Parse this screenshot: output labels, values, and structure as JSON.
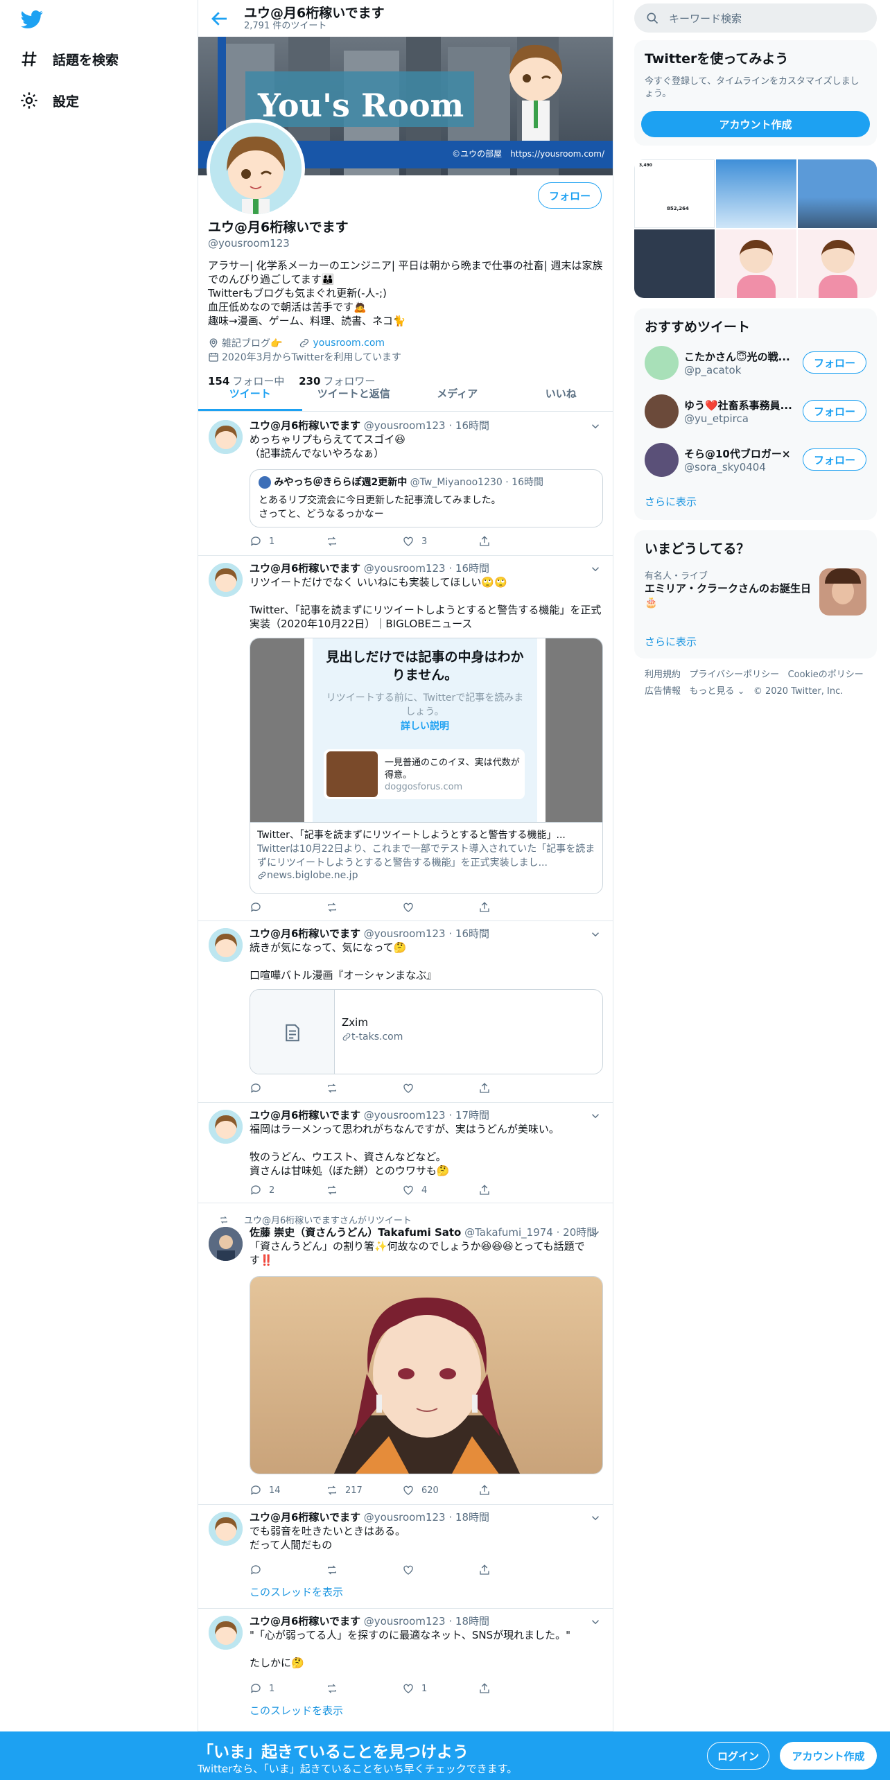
{
  "nav": {
    "logo_icon": "twitter-bird-icon",
    "explore": "話題を検索",
    "settings": "設定"
  },
  "header": {
    "name": "ユウ@月6桁稼いでます",
    "tweet_count": "2,791 件のツイート"
  },
  "banner": {
    "title": "You's Room",
    "caption": "©ユウの部屋　https://yousroom.com/"
  },
  "profile": {
    "follow_label": "フォロー",
    "name": "ユウ@月6桁稼いでます",
    "handle": "@yousroom123",
    "bio": "アラサー| 化学系メーカーのエンジニア| 平日は朝から晩まで仕事の社畜| 週末は家族でのんびり過ごしてます👪\nTwitterもブログも気まぐれ更新(-人-;)\n血圧低めなので朝活は苦手です🙇\n趣味→漫画、ゲーム、料理、読書、ネコ🐈",
    "location": "雑記ブログ👉",
    "url": "yousroom.com",
    "joined": "2020年3月からTwitterを利用しています",
    "following_count": "154",
    "following_label": "フォロー中",
    "followers_count": "230",
    "followers_label": "フォロワー"
  },
  "tabs": [
    "ツイート",
    "ツイートと返信",
    "メディア",
    "いいね"
  ],
  "tweets": [
    {
      "name": "ユウ@月6桁稼いでます",
      "handle": "@yousroom123",
      "time": "16時間",
      "text": "めっちゃリプもらえててスゴイ😆\n（記事読んでないやろなぁ）",
      "quote": {
        "name": "みやっち＠きららぽ週2更新中",
        "handle": "@Tw_Miyanoo1230",
        "time": "16時間",
        "text": "とあるリプ交流会に今日更新した記事流してみました。\nさってと、どうなるっかなー"
      },
      "reply": "1",
      "retweet": "",
      "like": "3"
    },
    {
      "name": "ユウ@月6桁稼いでます",
      "handle": "@yousroom123",
      "time": "16時間",
      "text": "リツイートだけでなく いいねにも実装してほしい🙄🙄\n\nTwitter、「記事を読まずにリツイートしようとすると警告する機能」を正式実装（2020年10月22日）｜BIGLOBEニュース",
      "card": {
        "overlay_title": "見出しだけでは記事の中身はわかりません。",
        "overlay_text": "リツイートする前に、Twitterで記事を読みましょう。",
        "overlay_link": "詳しい説明",
        "inner_title": "一見普通のこのイヌ、実は代数が得意。",
        "inner_domain": "doggosforus.com",
        "title": "Twitter、「記事を読まずにリツイートしようとすると警告する機能」...",
        "desc": "Twitterは10月22日より、これまで一部でテスト導入されていた「記事を読まずにリツイートしようとすると警告する機能」を正式実装しまし...",
        "domain": "news.biglobe.ne.jp"
      },
      "reply": "",
      "retweet": "",
      "like": ""
    },
    {
      "name": "ユウ@月6桁稼いでます",
      "handle": "@yousroom123",
      "time": "16時間",
      "text": "続きが気になって、気になって🤔\n\n口喧嘩バトル漫画『オーシャンまなぶ』",
      "card": {
        "title": "Zxim",
        "domain": "t-taks.com"
      },
      "reply": "",
      "retweet": "",
      "like": ""
    },
    {
      "name": "ユウ@月6桁稼いでます",
      "handle": "@yousroom123",
      "time": "17時間",
      "text": "福岡はラーメンって思われがちなんですが、実はうどんが美味い。\n\n牧のうどん、ウエスト、資さんなどなど。\n資さんは甘味処（ぼた餅）とのウワサも🤔",
      "reply": "2",
      "retweet": "",
      "like": "4"
    },
    {
      "retweeted_by": "ユウ@月6桁稼いでますさんがリツイート",
      "name": "佐藤 崇史（資さんうどん）Takafumi Sato",
      "handle": "@Takafumi_1974",
      "time": "20時間",
      "text": "「資さんうどん」の割り箸✨何故なのでしょうか😆😆😆とっても話題です‼️",
      "reply": "14",
      "retweet": "217",
      "like": "620"
    },
    {
      "name": "ユウ@月6桁稼いでます",
      "handle": "@yousroom123",
      "time": "18時間",
      "text": "でも弱音を吐きたいときはある。\nだって人間だもの",
      "show_thread": "このスレッドを表示",
      "reply": "",
      "retweet": "",
      "like": ""
    },
    {
      "name": "ユウ@月6桁稼いでます",
      "handle": "@yousroom123",
      "time": "18時間",
      "text": "\"「心が弱ってる人」を探すのに最適なネット、SNSが現れました。\"\n\nたしかに🤔",
      "show_thread": "このスレッドを表示",
      "reply": "1",
      "retweet": "",
      "like": "1"
    }
  ],
  "right": {
    "search_placeholder": "キーワード検索",
    "signup_box": {
      "title": "Twitterを使ってみよう",
      "text": "今すぐ登録して、タイムラインをカスタマイズしましょう。",
      "button": "アカウント作成"
    },
    "media_stats": [
      "3,490",
      "852,264"
    ],
    "recommended": {
      "title": "おすすめツイート",
      "users": [
        {
          "name": "こたかさん😇光の戦...",
          "handle": "@p_acatok",
          "button": "フォロー"
        },
        {
          "name": "ゆう❤️社畜系事務員...",
          "handle": "@yu_etpirca",
          "button": "フォロー"
        },
        {
          "name": "そら@10代ブロガー×...",
          "handle": "@sora_sky0404",
          "button": "フォロー"
        }
      ],
      "more": "さらに表示"
    },
    "trends": {
      "title": "いまどうしてる？",
      "category": "有名人・ライブ",
      "headline": "エミリア・クラークさんのお誕生日🎂",
      "more": "さらに表示"
    },
    "footer": {
      "links": [
        "利用規約",
        "プライバシーポリシー",
        "Cookieのポリシー",
        "広告情報",
        "もっと見る"
      ],
      "copyright": "© 2020 Twitter, Inc."
    }
  },
  "bottom_bar": {
    "title": "「いま」起きていることを見つけよう",
    "subtitle": "Twitterなら、「いま」起きていることをいち早くチェックできます。",
    "login": "ログイン",
    "signup": "アカウント作成"
  },
  "colors": {
    "accent": "#1da1f2",
    "muted": "#5b7083",
    "border": "#e1e8ed"
  }
}
